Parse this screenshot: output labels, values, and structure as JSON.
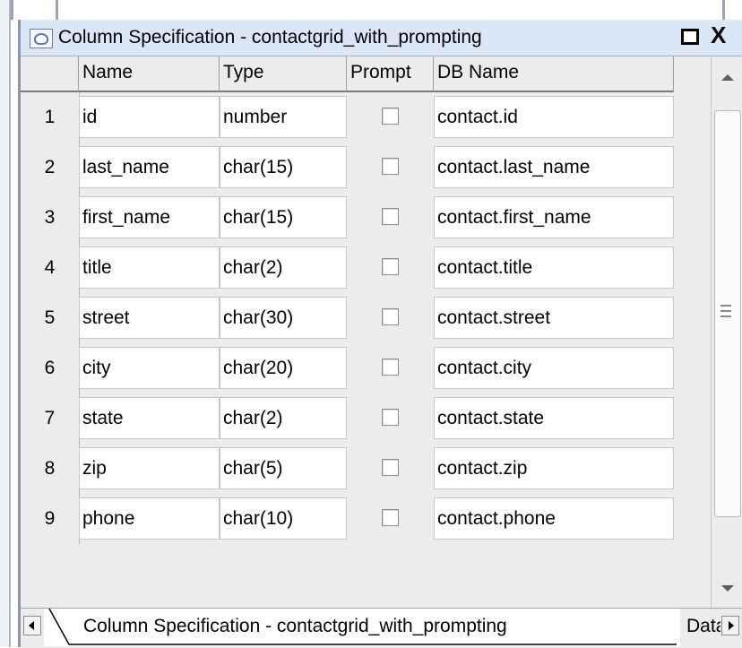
{
  "window": {
    "title": "Column Specification - contactgrid_with_prompting",
    "maximize_glyph": "",
    "close_glyph": "X"
  },
  "grid": {
    "columns": [
      "Name",
      "Type",
      "Prompt",
      "DB Name"
    ],
    "rows": [
      {
        "num": "1",
        "name": "id",
        "type": "number",
        "prompt": false,
        "db_name": "contact.id"
      },
      {
        "num": "2",
        "name": "last_name",
        "type": "char(15)",
        "prompt": false,
        "db_name": "contact.last_name"
      },
      {
        "num": "3",
        "name": "first_name",
        "type": "char(15)",
        "prompt": false,
        "db_name": "contact.first_name"
      },
      {
        "num": "4",
        "name": "title",
        "type": "char(2)",
        "prompt": false,
        "db_name": "contact.title"
      },
      {
        "num": "5",
        "name": "street",
        "type": "char(30)",
        "prompt": false,
        "db_name": "contact.street"
      },
      {
        "num": "6",
        "name": "city",
        "type": "char(20)",
        "prompt": false,
        "db_name": "contact.city"
      },
      {
        "num": "7",
        "name": "state",
        "type": "char(2)",
        "prompt": false,
        "db_name": "contact.state"
      },
      {
        "num": "8",
        "name": "zip",
        "type": "char(5)",
        "prompt": false,
        "db_name": "contact.zip"
      },
      {
        "num": "9",
        "name": "phone",
        "type": "char(10)",
        "prompt": false,
        "db_name": "contact.phone"
      }
    ]
  },
  "tabs": {
    "active_label": "Column Specification - contactgrid_with_prompting",
    "next_label": "Data"
  }
}
